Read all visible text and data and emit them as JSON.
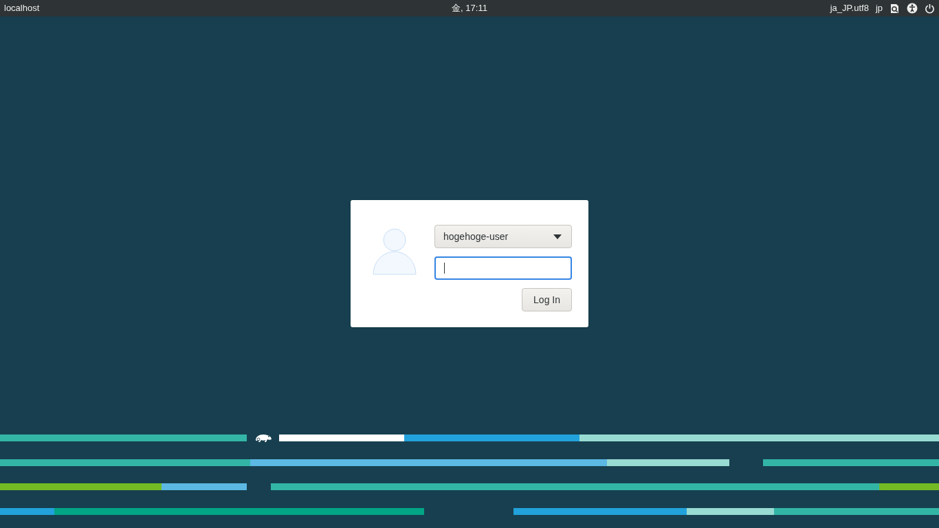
{
  "top_bar": {
    "host": "localhost",
    "clock": "金, 17:11",
    "locale": "ja_JP.utf8",
    "keyboard_layout": "jp"
  },
  "login": {
    "user_select": {
      "value": "hogehoge-user"
    },
    "password_field": {
      "focused": true
    },
    "button": "Log In"
  }
}
